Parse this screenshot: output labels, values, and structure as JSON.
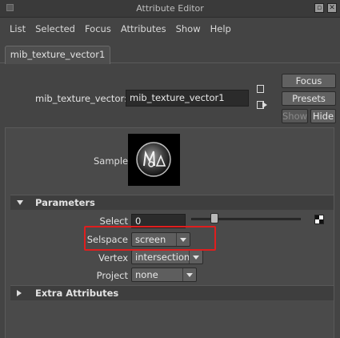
{
  "window": {
    "title": "Attribute Editor"
  },
  "menu": {
    "items": [
      "List",
      "Selected",
      "Focus",
      "Attributes",
      "Show",
      "Help"
    ]
  },
  "tab": {
    "label": "mib_texture_vector1"
  },
  "node": {
    "label": "mib_texture_vector:",
    "value": "mib_texture_vector1"
  },
  "buttons": {
    "focus": "Focus",
    "presets": "Presets",
    "show": "Show",
    "hide": "Hide"
  },
  "sample": {
    "label": "Sample"
  },
  "sections": {
    "parameters": "Parameters",
    "extra": "Extra Attributes"
  },
  "params": {
    "select": {
      "label": "Select",
      "value": "0",
      "slider_fraction": 0.19
    },
    "selspace": {
      "label": "Selspace",
      "value": "screen"
    },
    "vertex": {
      "label": "Vertex",
      "value": "intersection"
    },
    "project": {
      "label": "Project",
      "value": "none"
    }
  },
  "colors": {
    "highlight": "#e01e1e",
    "background": "#444444"
  }
}
